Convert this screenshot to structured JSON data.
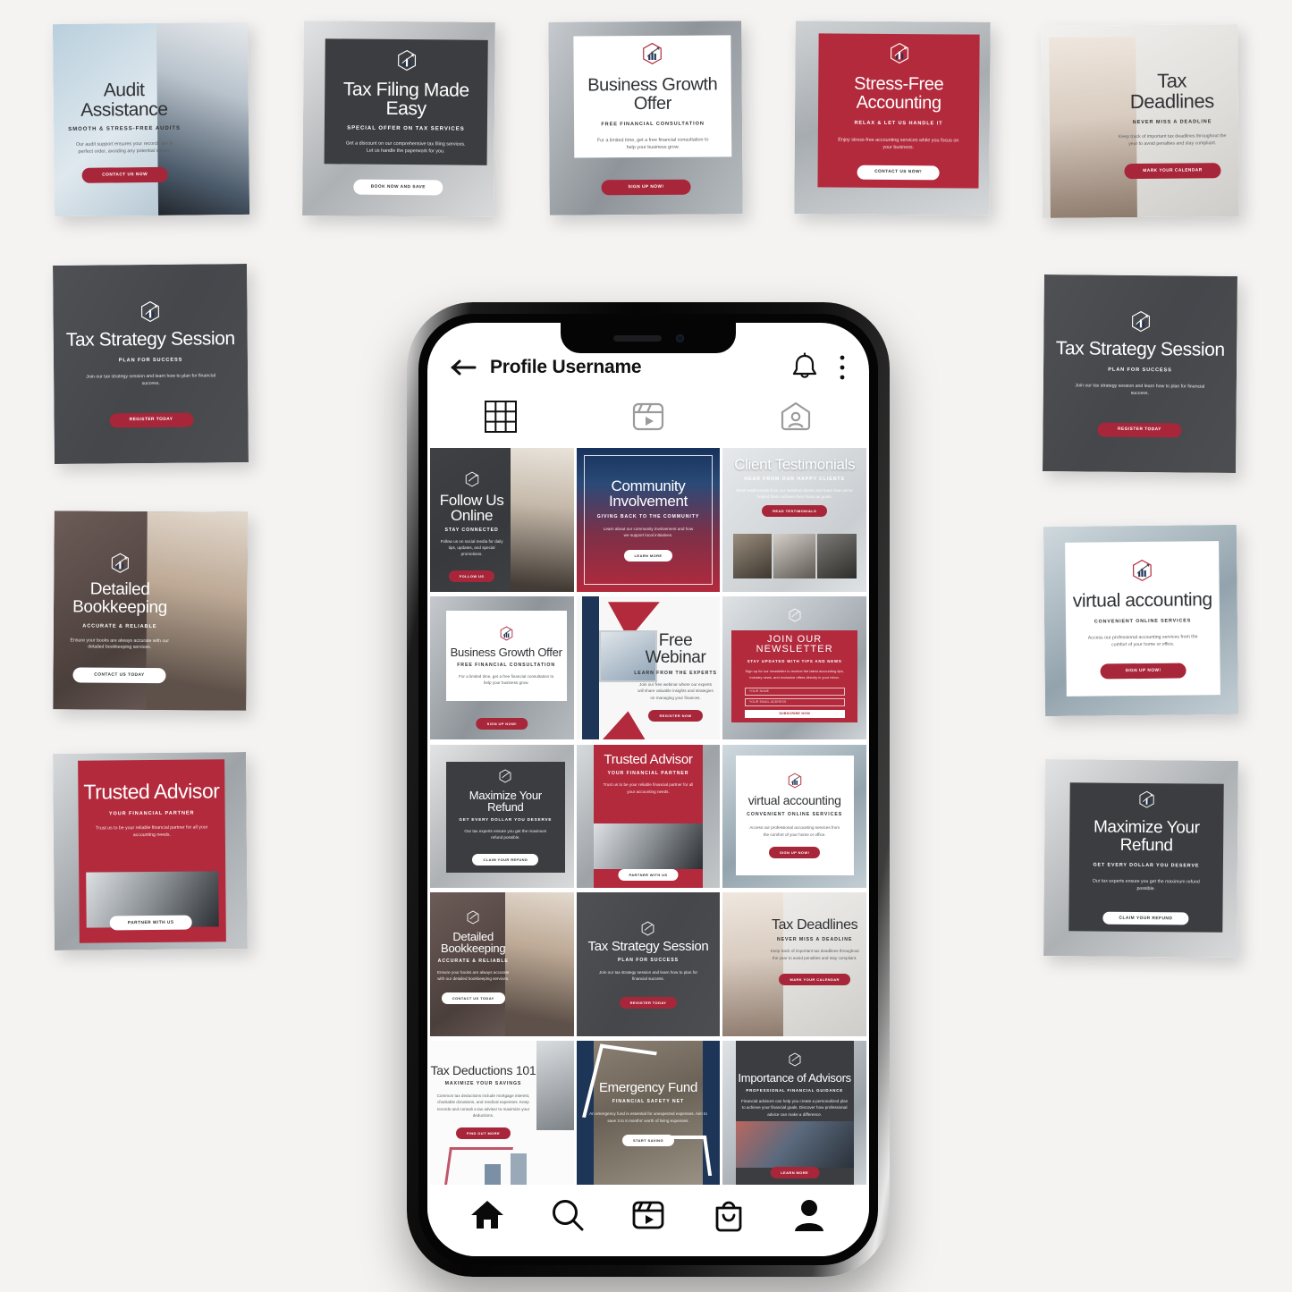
{
  "background_color": "#f4f3f2",
  "brand": {
    "red": "#b32a3c",
    "button_red": "#a8263a",
    "dark": "#3b3d40",
    "navy": "#1d3557",
    "logo_name": "accounting-hexagon-bar-chart-logo"
  },
  "phone": {
    "header": {
      "back_icon": "back-arrow-icon",
      "title": "Profile Username",
      "bell_icon": "bell-icon",
      "menu_icon": "three-dot-menu-icon"
    },
    "tabs": [
      {
        "name": "grid-tab",
        "icon": "grid-icon",
        "active": true
      },
      {
        "name": "reels-tab",
        "icon": "reels-icon",
        "active": false
      },
      {
        "name": "tagged-tab",
        "icon": "tagged-person-icon",
        "active": false
      }
    ],
    "bottom_nav": [
      {
        "name": "home",
        "icon": "home-icon"
      },
      {
        "name": "search",
        "icon": "search-icon"
      },
      {
        "name": "reels",
        "icon": "reels-icon"
      },
      {
        "name": "shop",
        "icon": "shopping-bag-icon"
      },
      {
        "name": "profile",
        "icon": "profile-person-icon"
      }
    ],
    "grid_posts": [
      {
        "id": "follow-us-online",
        "title": "Follow Us Online",
        "subtitle": "Stay Connected",
        "body": "Follow us on social media for daily tips, updates, and special promotions.",
        "button": "Follow Us",
        "style": "dark-overlay-photo"
      },
      {
        "id": "community-involvement",
        "title": "Community Involvement",
        "subtitle": "Giving Back to the Community",
        "body": "Learn about our community involvement and how we support local initiatives.",
        "button": "Learn More",
        "style": "blue-red-gradient"
      },
      {
        "id": "client-testimonials",
        "title": "Client Testimonials",
        "subtitle": "Hear From Our Happy Clients",
        "body": "Read testimonials from our satisfied clients and learn how we've helped them achieve their financial goals.",
        "button": "Read Testimonials",
        "style": "grayscale-photo-collage"
      },
      {
        "id": "business-growth-offer-grid",
        "title": "Business Growth Offer",
        "subtitle": "Free Financial Consultation",
        "body": "For a limited time, get a free financial consultation to help your business grow.",
        "button": "Sign Up Now!",
        "style": "white-panel"
      },
      {
        "id": "free-webinar",
        "title": "Free Webinar",
        "subtitle": "Learn From the Experts",
        "body": "Join our free webinar where our experts will share valuable insights and strategies on managing your finances.",
        "button": "Register Now",
        "style": "white-navy-red"
      },
      {
        "id": "join-our-newsletter",
        "title": "Join Our Newsletter",
        "subtitle": "Stay Updated With Tips and News",
        "body": "Sign up for our newsletter to receive the latest accounting tips, industry news, and exclusive offers directly in your inbox.",
        "field_name_placeholder": "Your Name",
        "field_email_placeholder": "Your Email Address",
        "button": "Subscribe Now",
        "style": "red-panel-form"
      },
      {
        "id": "maximize-your-refund-grid",
        "title": "Maximize Your Refund",
        "subtitle": "Get Every Dollar You Deserve",
        "body": "Our tax experts ensure you get the maximum refund possible.",
        "button": "Claim Your Refund",
        "style": "dark-panel"
      },
      {
        "id": "trusted-advisor-grid",
        "title": "Trusted Advisor",
        "subtitle": "Your Financial Partner",
        "body": "Trust us to be your reliable financial partner for all your accounting needs.",
        "button": "Partner With Us",
        "style": "red-panel-photo"
      },
      {
        "id": "virtual-accounting-grid",
        "title": "virtual accounting",
        "subtitle": "Convenient Online Services",
        "body": "Access our professional accounting services from the comfort of your home or office.",
        "button": "Sign Up Now!",
        "style": "white-panel"
      },
      {
        "id": "detailed-bookkeeping-grid",
        "title": "Detailed Bookkeeping",
        "subtitle": "Accurate & Reliable",
        "body": "Ensure your books are always accurate with our detailed bookkeeping services.",
        "button": "Contact Us Today",
        "style": "warm-overlay-photo"
      },
      {
        "id": "tax-strategy-session-grid",
        "title": "Tax Strategy Session",
        "subtitle": "Plan For Success",
        "body": "Join our tax strategy session and learn how to plan for financial success.",
        "button": "Register Today",
        "style": "dark-overlay-photo"
      },
      {
        "id": "tax-deadlines-grid",
        "title": "Tax Deadlines",
        "subtitle": "Never Miss a Deadline",
        "body": "Keep track of important tax deadlines throughout the year to avoid penalties and stay compliant.",
        "button": "Mark Your Calendar",
        "style": "light-photo"
      },
      {
        "id": "tax-deductions-101",
        "title": "Tax Deductions 101",
        "subtitle": "Maximize Your Savings",
        "body": "Common tax deductions include mortgage interest, charitable donations, and medical expenses. Keep records and consult a tax advisor to maximize your deductions.",
        "button": "Find Out More",
        "style": "white-chart"
      },
      {
        "id": "emergency-fund",
        "title": "Emergency Fund",
        "subtitle": "Financial Safety Net",
        "body": "An emergency fund is essential for unexpected expenses. Aim to save 3 to 6 months' worth of living expenses.",
        "button": "Start Saving",
        "style": "plant-arrow"
      },
      {
        "id": "importance-of-advisors",
        "title": "Importance of Advisors",
        "subtitle": "Professional Financial Guidance",
        "body": "Financial advisors can help you create a personalized plan to achieve your financial goals. Discover how professional advice can make a difference.",
        "button": "Learn More",
        "style": "dark-panel-photo"
      }
    ]
  },
  "surrounding_mockups": [
    {
      "id": "audit-assistance",
      "title": "Audit Assistance",
      "subtitle": "Smooth & Stress-Free Audits",
      "body": "Our audit support ensures your records are in perfect order, avoiding any potential issues.",
      "button": "Contact Us Now"
    },
    {
      "id": "tax-filing-made-easy",
      "title": "Tax Filing Made Easy",
      "subtitle": "Special Offer on Tax Services",
      "body": "Get a discount on our comprehensive tax filing services. Let us handle the paperwork for you.",
      "button": "Book Now and Save"
    },
    {
      "id": "business-growth-offer",
      "title": "Business Growth Offer",
      "subtitle": "Free Financial Consultation",
      "body": "For a limited time, get a free financial consultation to help your business grow.",
      "button": "Sign Up Now!"
    },
    {
      "id": "stress-free-accounting",
      "title": "Stress-Free Accounting",
      "subtitle": "Relax & Let Us Handle It",
      "body": "Enjoy stress-free accounting services while you focus on your business.",
      "button": "Contact Us Now!"
    },
    {
      "id": "tax-deadlines",
      "title": "Tax Deadlines",
      "subtitle": "Never Miss a Deadline",
      "body": "Keep track of important tax deadlines throughout the year to avoid penalties and stay compliant.",
      "button": "Mark Your Calendar"
    },
    {
      "id": "tax-strategy-session-left",
      "title": "Tax Strategy Session",
      "subtitle": "Plan For Success",
      "body": "Join our tax strategy session and learn how to plan for financial success.",
      "button": "Register Today"
    },
    {
      "id": "detailed-bookkeeping",
      "title": "Detailed Bookkeeping",
      "subtitle": "Accurate & Reliable",
      "body": "Ensure your books are always accurate with our detailed bookkeeping services.",
      "button": "Contact Us Today"
    },
    {
      "id": "trusted-advisor",
      "title": "Trusted Advisor",
      "subtitle": "Your Financial Partner",
      "body": "Trust us to be your reliable financial partner for all your accounting needs.",
      "button": "Partner With Us"
    },
    {
      "id": "tax-strategy-session-right",
      "title": "Tax Strategy Session",
      "subtitle": "Plan For Success",
      "body": "Join our tax strategy session and learn how to plan for financial success.",
      "button": "Register Today"
    },
    {
      "id": "virtual-accounting",
      "title": "virtual accounting",
      "subtitle": "Convenient Online Services",
      "body": "Access our professional accounting services from the comfort of your home or office.",
      "button": "Sign Up Now!"
    },
    {
      "id": "maximize-your-refund",
      "title": "Maximize Your Refund",
      "subtitle": "Get Every Dollar You Deserve",
      "body": "Our tax experts ensure you get the maximum refund possible.",
      "button": "Claim Your Refund"
    }
  ]
}
